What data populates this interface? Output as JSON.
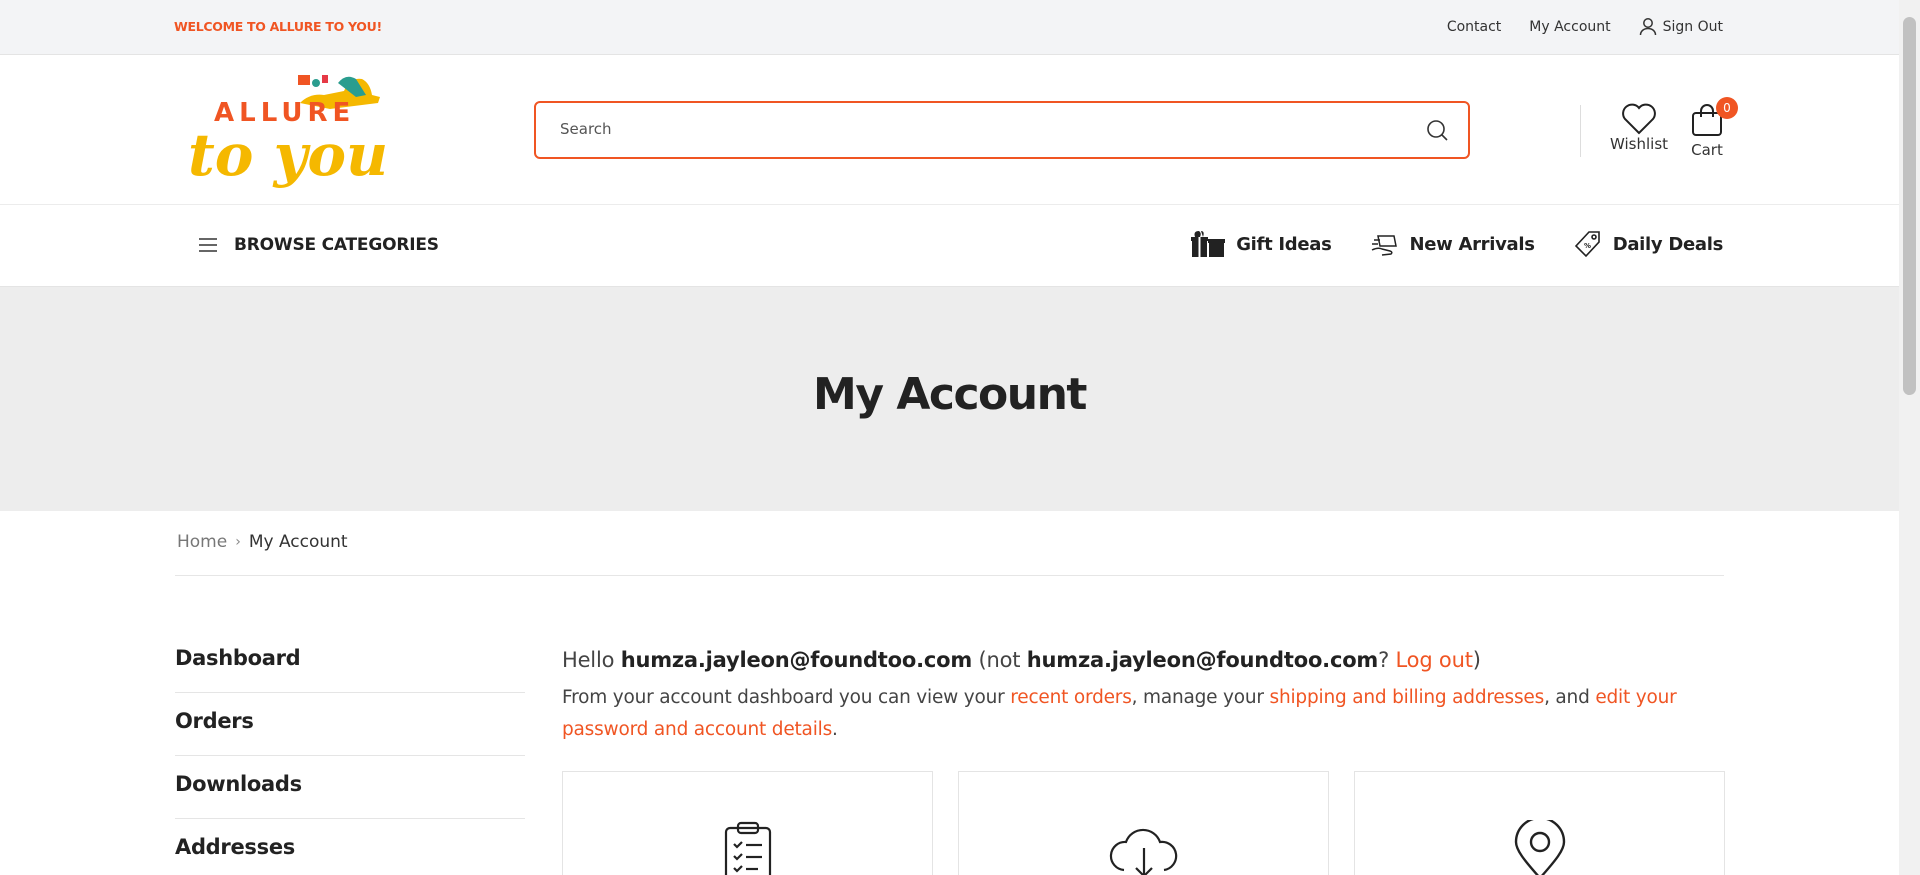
{
  "topbar": {
    "welcome": "WELCOME TO ALLURE TO YOU!",
    "contact": "Contact",
    "my_account": "My Account",
    "sign_out": "Sign Out"
  },
  "header": {
    "logo_top": "ALLURE",
    "logo_bottom": "to you",
    "search_placeholder": "Search",
    "wishlist_label": "Wishlist",
    "cart_label": "Cart",
    "cart_count": "0"
  },
  "nav": {
    "browse": "BROWSE CATEGORIES",
    "links": [
      {
        "label": "Gift Ideas",
        "icon": "gift-icon"
      },
      {
        "label": "New Arrivals",
        "icon": "delivery-icon"
      },
      {
        "label": "Daily Deals",
        "icon": "price-tag-icon"
      }
    ]
  },
  "page": {
    "title": "My Account",
    "breadcrumb_home": "Home",
    "breadcrumb_current": "My Account"
  },
  "sidebar": {
    "items": [
      {
        "label": "Dashboard"
      },
      {
        "label": "Orders"
      },
      {
        "label": "Downloads"
      },
      {
        "label": "Addresses"
      }
    ]
  },
  "dashboard": {
    "hello": "Hello",
    "user_email": "humza.jayleon@foundtoo.com",
    "not_open": "(not",
    "not_email": "humza.jayleon@foundtoo.com",
    "question": "?",
    "logout": "Log out",
    "close_paren": ")",
    "desc_1": "From your account dashboard you can view your",
    "link_orders": "recent orders",
    "desc_2": ", manage your",
    "link_addresses": "shipping and billing addresses",
    "desc_3": ", and",
    "link_password": "edit your password and account details",
    "desc_4": "."
  },
  "cards": [
    {
      "icon": "clipboard-checklist-icon"
    },
    {
      "icon": "cloud-download-icon"
    },
    {
      "icon": "map-pin-icon"
    }
  ],
  "colors": {
    "accent": "#f05523",
    "logo_yellow": "#f5b800"
  }
}
